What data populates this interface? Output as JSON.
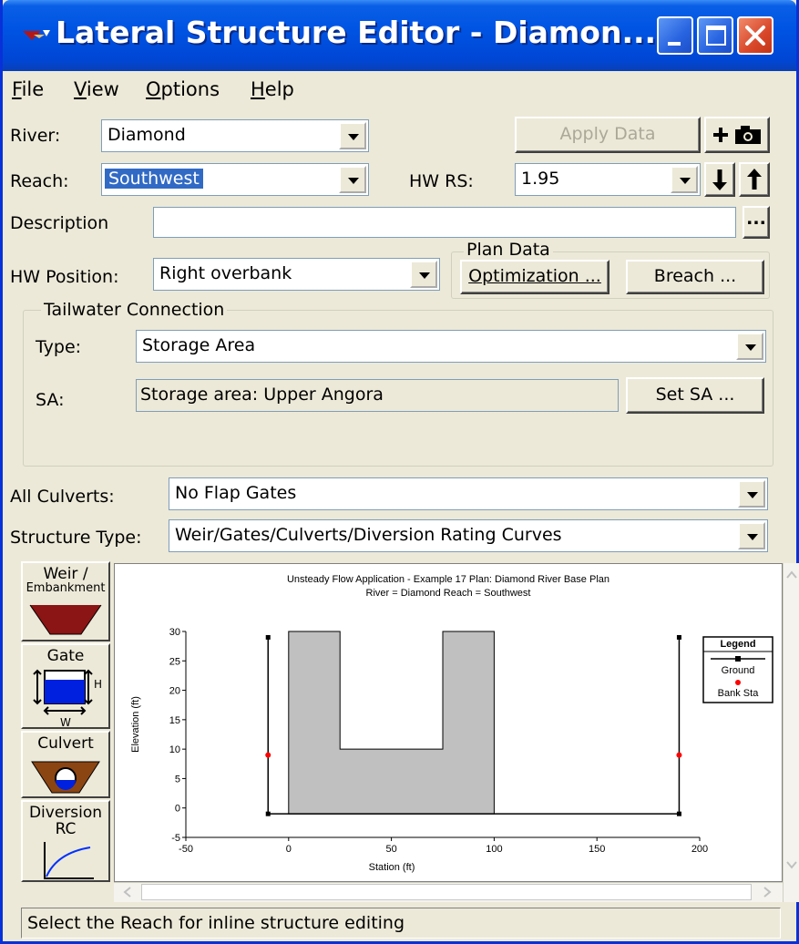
{
  "window": {
    "title": "Lateral Structure Editor - Diamon..."
  },
  "menu": [
    {
      "key": "F",
      "rest": "ile"
    },
    {
      "key": "V",
      "rest": "iew"
    },
    {
      "key": "O",
      "rest": "ptions"
    },
    {
      "key": "H",
      "rest": "elp"
    }
  ],
  "form": {
    "river_label": "River:",
    "river_value": "Diamond",
    "reach_label": "Reach:",
    "reach_value": "Southwest",
    "apply_data": "Apply Data",
    "hw_rs_label": "HW RS:",
    "hw_rs_value": "1.95",
    "description_label": "Description",
    "description_value": "",
    "browse_button": "...",
    "hw_position_label": "HW Position:",
    "hw_position_value": "Right overbank",
    "plan_data_title": "Plan Data",
    "optimization_button": "Optimization ...",
    "breach_button": "Breach ..."
  },
  "tailwater": {
    "title": "Tailwater Connection",
    "type_label": "Type:",
    "type_value": "Storage Area",
    "sa_label": "SA:",
    "sa_value": "Storage area: Upper Angora",
    "set_sa_button": "Set SA ..."
  },
  "culverts": {
    "label": "All Culverts:",
    "value": "No Flap Gates"
  },
  "structure_type": {
    "label": "Structure Type:",
    "value": "Weir/Gates/Culverts/Diversion Rating Curves"
  },
  "side_tabs": {
    "weir_line1": "Weir /",
    "weir_line2": "Embankment",
    "gate": "Gate",
    "gate_h": "H",
    "gate_w": "W",
    "culvert": "Culvert",
    "diversion_line1": "Diversion",
    "diversion_line2": "RC"
  },
  "chart_data": {
    "type": "area",
    "title": "Unsteady Flow Application - Example 17      Plan: Diamond River Base Plan",
    "subtitle": "River = Diamond    Reach = Southwest",
    "xlabel": "Station (ft)",
    "ylabel": "Elevation (ft)",
    "xlim": [
      -50,
      200
    ],
    "ylim": [
      -5,
      30
    ],
    "xticks": [
      -50,
      0,
      50,
      100,
      150,
      200
    ],
    "yticks": [
      -5,
      0,
      5,
      10,
      15,
      20,
      25,
      30
    ],
    "weir_profile": {
      "x": [
        0,
        0,
        25,
        25,
        75,
        75,
        100,
        100
      ],
      "y": [
        -1,
        30,
        30,
        10,
        10,
        30,
        30,
        -1
      ]
    },
    "series": [
      {
        "name": "Ground",
        "x": [
          -10,
          -10,
          190,
          190
        ],
        "y": [
          29,
          -1,
          -1,
          29
        ]
      },
      {
        "name": "Bank Sta",
        "x": [
          -10,
          190
        ],
        "y": [
          9,
          9
        ]
      }
    ],
    "legend": {
      "title": "Legend",
      "position": "top-right"
    },
    "colors": {
      "fill": "#c0c0c0",
      "bank": "#ff0000",
      "ground": "#000000"
    }
  },
  "status": {
    "text": "Select the Reach for inline structure editing"
  }
}
